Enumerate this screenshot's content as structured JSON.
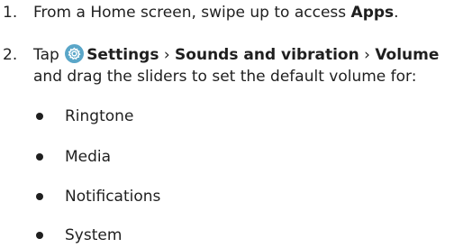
{
  "steps": [
    {
      "number": "1.",
      "text_before": "From a Home screen, swipe up to access ",
      "bold": "Apps",
      "text_after": "."
    },
    {
      "number": "2.",
      "tap_label": "Tap ",
      "icon": "settings-gear-icon",
      "icon_color": "#5aa6c8",
      "settings_label": "Settings",
      "separator_1": " › ",
      "sounds_label": "Sounds and vibration",
      "separator_2": " › ",
      "volume_label": "Volume",
      "line2": "and drag the sliders to set the default volume for:"
    }
  ],
  "bullets": [
    "Ringtone",
    "Media",
    "Notifications",
    "System"
  ]
}
